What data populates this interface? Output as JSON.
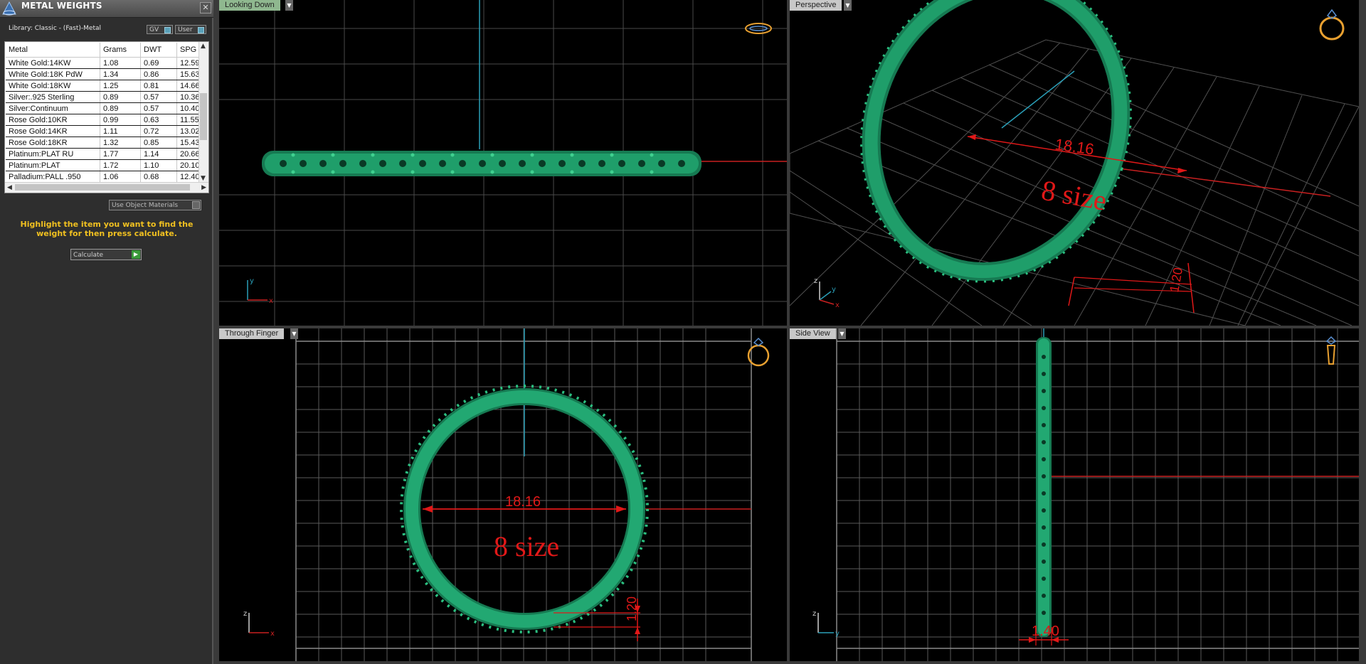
{
  "panel": {
    "title": "METAL WEIGHTS",
    "close_glyph": "✕",
    "library": "Library: Classic - (Fast)-Metal",
    "toggle_gv": "GV",
    "toggle_user": "User",
    "columns": [
      "Metal",
      "Grams",
      "DWT",
      "SPG"
    ],
    "rows": [
      [
        "White Gold:14KW",
        "1.08",
        "0.69",
        "12.59"
      ],
      [
        "White Gold:18K PdW",
        "1.34",
        "0.86",
        "15.63"
      ],
      [
        "White Gold:18KW",
        "1.25",
        "0.81",
        "14.66"
      ],
      [
        "Silver:.925 Sterling",
        "0.89",
        "0.57",
        "10.36"
      ],
      [
        "Silver:Continuum",
        "0.89",
        "0.57",
        "10.40"
      ],
      [
        "Rose Gold:10KR",
        "0.99",
        "0.63",
        "11.55"
      ],
      [
        "Rose Gold:14KR",
        "1.11",
        "0.72",
        "13.02"
      ],
      [
        "Rose Gold:18KR",
        "1.32",
        "0.85",
        "15.43"
      ],
      [
        "Platinum:PLAT RU",
        "1.77",
        "1.14",
        "20.66"
      ],
      [
        "Platinum:PLAT",
        "1.72",
        "1.10",
        "20.10"
      ],
      [
        "Palladium:PALL .950",
        "1.06",
        "0.68",
        "12.40"
      ]
    ],
    "use_object_materials": "Use Object Materials",
    "hint": "Highlight the item you want to find the weight for then press calculate.",
    "calculate": "Calculate"
  },
  "viewports": {
    "top_left": {
      "label": "Looking Down",
      "axis_x": "x",
      "axis_y": "y"
    },
    "top_right": {
      "label": "Perspective",
      "dim_diameter": "18.16",
      "size_text": "8 size",
      "dim_thickness": "1.20",
      "axis_x": "x",
      "axis_y": "y",
      "axis_z": "z"
    },
    "bottom_left": {
      "label": "Through Finger",
      "dim_diameter": "18.16",
      "size_text": "8 size",
      "dim_thickness": "1.20",
      "axis_x": "x",
      "axis_z": "z"
    },
    "bottom_right": {
      "label": "Side View",
      "dim_width": "1.40",
      "axis_y": "y",
      "axis_z": "z"
    }
  },
  "colors": {
    "ring_green": "#1f9e6a",
    "dimension_red": "#e01818",
    "axis_cyan": "#2a9fb8",
    "grid_gray": "#4a4a4a",
    "hint_yellow": "#f0c020"
  }
}
